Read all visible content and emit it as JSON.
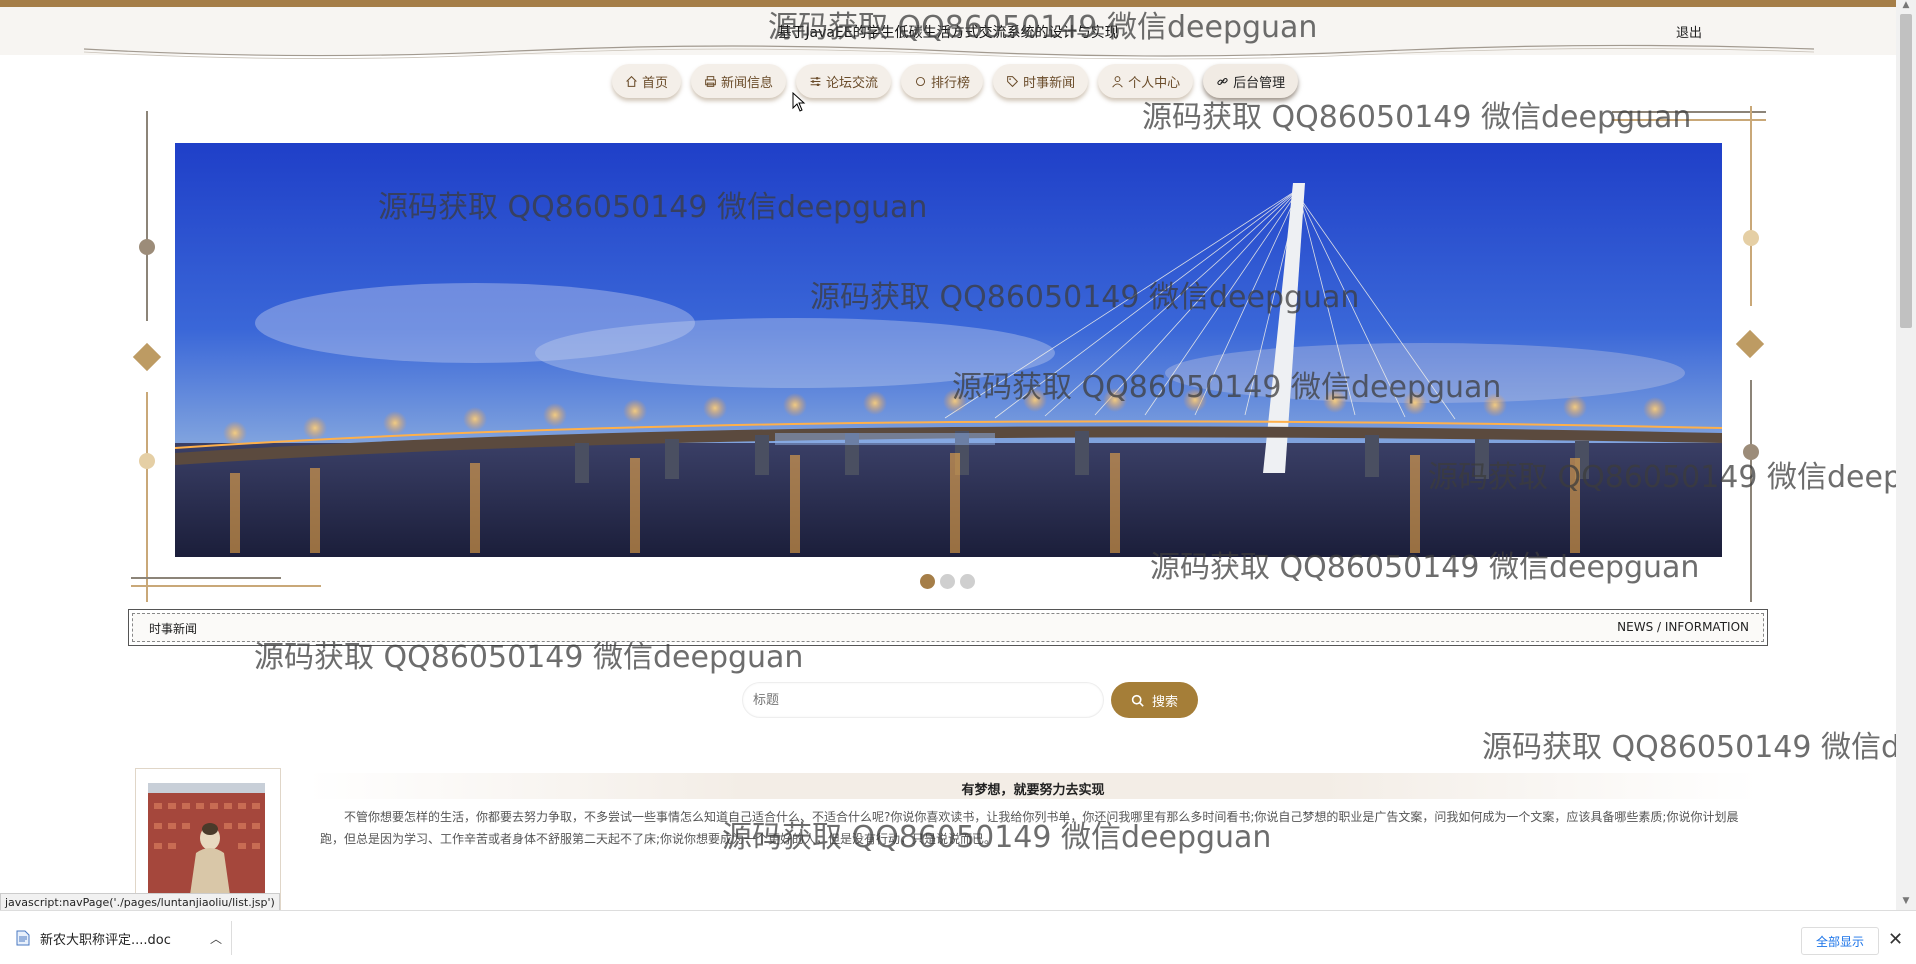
{
  "header": {
    "title": "基于JavaEE的学生低碳生活方式交流系统的设计与实现",
    "logout": "退出"
  },
  "nav": {
    "items": [
      {
        "label": "首页",
        "icon": "home-icon"
      },
      {
        "label": "新闻信息",
        "icon": "printer-icon"
      },
      {
        "label": "论坛交流",
        "icon": "sliders-icon"
      },
      {
        "label": "排行榜",
        "icon": "circle-icon"
      },
      {
        "label": "时事新闻",
        "icon": "tag-icon"
      },
      {
        "label": "个人中心",
        "icon": "user-icon"
      },
      {
        "label": "后台管理",
        "icon": "link-icon"
      }
    ],
    "active_index": 6
  },
  "banner": {
    "slide_count": 3,
    "active_slide": 1
  },
  "section": {
    "title": "时事新闻",
    "subtitle": "NEWS / INFORMATION"
  },
  "search": {
    "placeholder": "标题",
    "button_label": "搜索"
  },
  "article": {
    "title": "有梦想，就要努力去实现",
    "text": "不管你想要怎样的生活，你都要去努力争取，不多尝试一些事情怎么知道自己适合什么、不适合什么呢?你说你喜欢读书，让我给你列书单，你还问我哪里有那么多时间看书;你说自己梦想的职业是广告文案，问我如何成为一个文案，应该具备哪些素质;你说你计划晨跑，但总是因为学习、工作辛苦或者身体不舒服第二天起不了床;你说你想要成为一个更好的人，但是没有行动，只是说说而已。"
  },
  "status_url": "javascript:navPage('./pages/luntanjiaoliu/list.jsp')",
  "download": {
    "file_name": "新农大职称评定....doc",
    "show_all": "全部显示"
  },
  "watermark": "源码获取 QQ86050149 微信deepguan",
  "colors": {
    "accent": "#a57e48",
    "button": "#a57e38",
    "decor": "#c9a878"
  }
}
